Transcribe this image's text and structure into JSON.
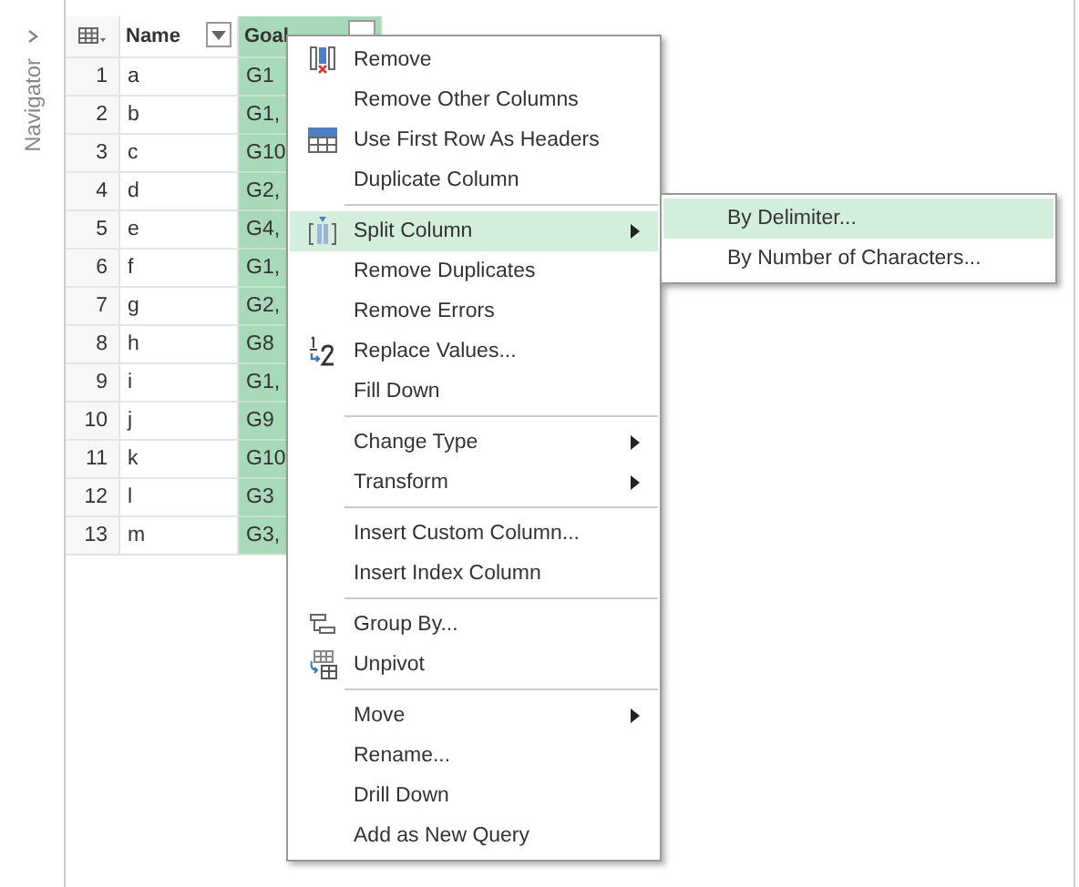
{
  "navigator": {
    "label": "Navigator"
  },
  "table": {
    "columns": [
      {
        "label": "Name",
        "selected": false
      },
      {
        "label": "Goal",
        "selected": true
      }
    ],
    "rows": [
      {
        "index": "1",
        "name": "a",
        "goal": "G1"
      },
      {
        "index": "2",
        "name": "b",
        "goal": "G1,"
      },
      {
        "index": "3",
        "name": "c",
        "goal": "G10"
      },
      {
        "index": "4",
        "name": "d",
        "goal": "G2,"
      },
      {
        "index": "5",
        "name": "e",
        "goal": "G4,"
      },
      {
        "index": "6",
        "name": "f",
        "goal": "G1,"
      },
      {
        "index": "7",
        "name": "g",
        "goal": "G2,"
      },
      {
        "index": "8",
        "name": "h",
        "goal": "G8"
      },
      {
        "index": "9",
        "name": "i",
        "goal": "G1,"
      },
      {
        "index": "10",
        "name": "j",
        "goal": "G9"
      },
      {
        "index": "11",
        "name": "k",
        "goal": "G10"
      },
      {
        "index": "12",
        "name": "l",
        "goal": "G3"
      },
      {
        "index": "13",
        "name": "m",
        "goal": "G3,"
      }
    ]
  },
  "context_menu": {
    "items": [
      {
        "kind": "item",
        "label": "Remove",
        "submenu": false,
        "selected": false
      },
      {
        "kind": "item",
        "label": "Remove Other Columns",
        "submenu": false,
        "selected": false
      },
      {
        "kind": "item",
        "label": "Use First Row As Headers",
        "submenu": false,
        "selected": false
      },
      {
        "kind": "item",
        "label": "Duplicate Column",
        "submenu": false,
        "selected": false
      },
      {
        "kind": "separator"
      },
      {
        "kind": "item",
        "label": "Split Column",
        "submenu": true,
        "selected": true
      },
      {
        "kind": "item",
        "label": "Remove Duplicates",
        "submenu": false,
        "selected": false
      },
      {
        "kind": "item",
        "label": "Remove Errors",
        "submenu": false,
        "selected": false
      },
      {
        "kind": "item",
        "label": "Replace Values...",
        "submenu": false,
        "selected": false
      },
      {
        "kind": "item",
        "label": "Fill Down",
        "submenu": false,
        "selected": false
      },
      {
        "kind": "separator"
      },
      {
        "kind": "item",
        "label": "Change Type",
        "submenu": true,
        "selected": false
      },
      {
        "kind": "item",
        "label": "Transform",
        "submenu": true,
        "selected": false
      },
      {
        "kind": "separator"
      },
      {
        "kind": "item",
        "label": "Insert Custom Column...",
        "submenu": false,
        "selected": false
      },
      {
        "kind": "item",
        "label": "Insert Index Column",
        "submenu": false,
        "selected": false
      },
      {
        "kind": "separator"
      },
      {
        "kind": "item",
        "label": "Group By...",
        "submenu": false,
        "selected": false
      },
      {
        "kind": "item",
        "label": "Unpivot",
        "submenu": false,
        "selected": false
      },
      {
        "kind": "separator"
      },
      {
        "kind": "item",
        "label": "Move",
        "submenu": true,
        "selected": false
      },
      {
        "kind": "item",
        "label": "Rename...",
        "submenu": false,
        "selected": false
      },
      {
        "kind": "item",
        "label": "Drill Down",
        "submenu": false,
        "selected": false
      },
      {
        "kind": "item",
        "label": "Add as New Query",
        "submenu": false,
        "selected": false
      }
    ]
  },
  "submenu": {
    "items": [
      {
        "label": "By Delimiter...",
        "selected": true
      },
      {
        "label": "By Number of Characters...",
        "selected": false
      }
    ]
  }
}
